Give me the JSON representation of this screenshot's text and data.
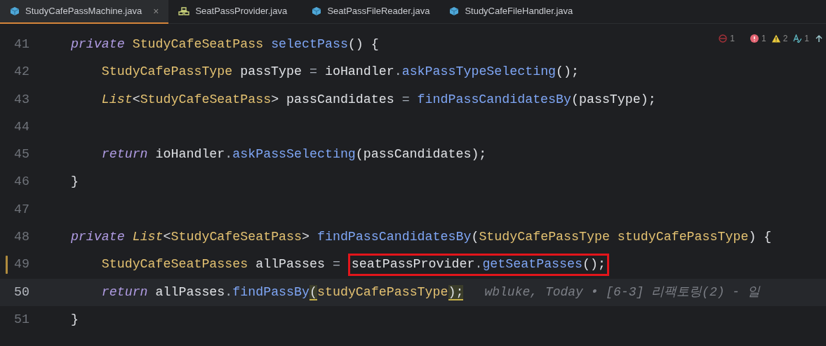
{
  "tabs": [
    {
      "label": "StudyCafePassMachine.java",
      "kind": "cube",
      "selected": true,
      "closable": true
    },
    {
      "label": "SeatPassProvider.java",
      "kind": "structure",
      "selected": false,
      "closable": false
    },
    {
      "label": "SeatPassFileReader.java",
      "kind": "cube",
      "selected": false,
      "closable": false
    },
    {
      "label": "StudyCafeFileHandler.java",
      "kind": "cube",
      "selected": false,
      "closable": false
    }
  ],
  "close_glyph": "×",
  "indicators": [
    {
      "kind": "blocked",
      "count": "1"
    },
    {
      "kind": "error",
      "count": "1"
    },
    {
      "kind": "warning",
      "count": "2"
    },
    {
      "kind": "typo",
      "count": "1"
    },
    {
      "kind": "up"
    }
  ],
  "lines": [
    {
      "number": "41",
      "modified": false,
      "current": false,
      "tokens": [
        {
          "text": "    private",
          "kind": "keyword"
        },
        {
          "text": " StudyCafeSeatPass",
          "kind": "type"
        },
        {
          "text": " selectPass",
          "kind": "method"
        },
        {
          "text": "() {",
          "kind": "punct"
        }
      ]
    },
    {
      "number": "42",
      "modified": false,
      "current": false,
      "tokens": [
        {
          "text": "        StudyCafePassType",
          "kind": "type"
        },
        {
          "text": " passType ",
          "kind": "plain"
        },
        {
          "text": "= ",
          "kind": "op"
        },
        {
          "text": "ioHandler",
          "kind": "plain"
        },
        {
          "text": ".",
          "kind": "op"
        },
        {
          "text": "askPassTypeSelecting",
          "kind": "method"
        },
        {
          "text": "();",
          "kind": "punct"
        }
      ]
    },
    {
      "number": "43",
      "modified": false,
      "current": false,
      "tokens": [
        {
          "text": "        List",
          "kind": "itype"
        },
        {
          "text": "<",
          "kind": "punct"
        },
        {
          "text": "StudyCafeSeatPass",
          "kind": "type"
        },
        {
          "text": "> passCandidates ",
          "kind": "plain"
        },
        {
          "text": "= ",
          "kind": "op"
        },
        {
          "text": "findPassCandidatesBy",
          "kind": "method"
        },
        {
          "text": "(passType);",
          "kind": "punct"
        }
      ]
    },
    {
      "number": "44",
      "modified": false,
      "current": false
    },
    {
      "number": "45",
      "modified": false,
      "current": false,
      "tokens": [
        {
          "text": "        return",
          "kind": "keyword"
        },
        {
          "text": " ioHandler",
          "kind": "plain"
        },
        {
          "text": ".",
          "kind": "op"
        },
        {
          "text": "askPassSelecting",
          "kind": "method"
        },
        {
          "text": "(passCandidates);",
          "kind": "punct"
        }
      ]
    },
    {
      "number": "46",
      "modified": false,
      "current": false,
      "tokens": [
        {
          "text": "    }",
          "kind": "punct"
        }
      ]
    },
    {
      "number": "47",
      "modified": false,
      "current": false
    },
    {
      "number": "48",
      "modified": false,
      "current": false,
      "tokens": [
        {
          "text": "    private",
          "kind": "keyword"
        },
        {
          "text": " List",
          "kind": "itype"
        },
        {
          "text": "<",
          "kind": "punct"
        },
        {
          "text": "StudyCafeSeatPass",
          "kind": "type"
        },
        {
          "text": "> ",
          "kind": "punct"
        },
        {
          "text": "findPassCandidatesBy",
          "kind": "method"
        },
        {
          "text": "(",
          "kind": "punct"
        },
        {
          "text": "StudyCafePassType",
          "kind": "type"
        },
        {
          "text": " studyCafePassType",
          "kind": "type"
        },
        {
          "text": ") {",
          "kind": "punct"
        }
      ]
    },
    {
      "number": "49",
      "modified": true,
      "current": false,
      "tokens": [
        {
          "text": "        StudyCafeSeatPasses",
          "kind": "type"
        },
        {
          "text": " allPasses ",
          "kind": "plain"
        },
        {
          "text": "= ",
          "kind": "op"
        },
        {
          "text": "seatPassProvider",
          "kind": "plain",
          "boxed": true
        },
        {
          "text": ".",
          "kind": "op",
          "boxed": true
        },
        {
          "text": "getSeatPasses",
          "kind": "method",
          "boxed": true
        },
        {
          "text": "();",
          "kind": "punct",
          "boxed": true
        }
      ]
    },
    {
      "number": "50",
      "modified": false,
      "current": true,
      "tokens": [
        {
          "text": "        return",
          "kind": "keyword"
        },
        {
          "text": " allPasses",
          "kind": "plain"
        },
        {
          "text": ".",
          "kind": "op"
        },
        {
          "text": "findPassBy",
          "kind": "method"
        },
        {
          "text": "(",
          "kind": "punct",
          "matched": true
        },
        {
          "text": "studyCafePassType",
          "kind": "type"
        },
        {
          "text": ")",
          "kind": "punct",
          "matched": true
        },
        {
          "text": ";",
          "kind": "punct",
          "matched": true
        }
      ],
      "blame": "wbluke, Today • [6-3] 리팩토링(2) - 일"
    },
    {
      "number": "51",
      "modified": false,
      "current": false,
      "tokens": [
        {
          "text": "    }",
          "kind": "punct"
        }
      ]
    }
  ]
}
